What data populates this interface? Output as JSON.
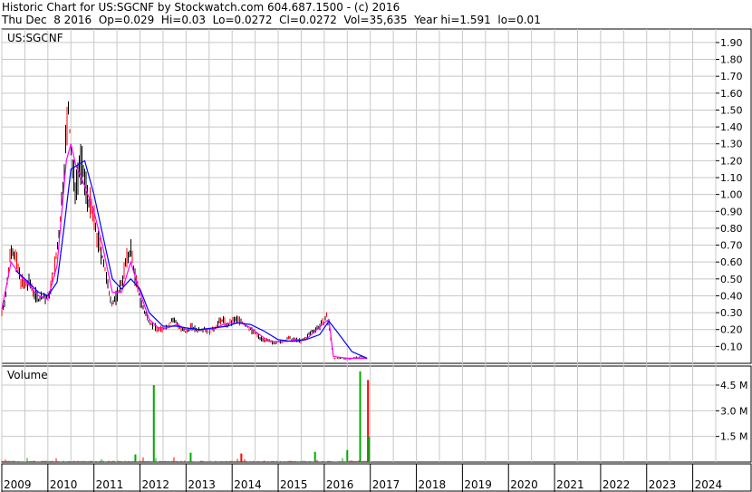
{
  "header": {
    "line1": "Historic Chart for US:SGCNF by Stockwatch.com 604.687.1500 - (c) 2016",
    "line2": "Thu Dec  8 2016  Op=0.029  Hi=0.03  Lo=0.0272  Cl=0.0272  Vol=35,635  Year hi=1.591  lo=0.01"
  },
  "colors": {
    "background": "#ffffff",
    "grid": "#c8c8c8",
    "price_bar": "#000000",
    "price_down": "#ff0000",
    "ma_short": "#ff00ff",
    "ma_long": "#0000ff",
    "volume_normal": "#ff0000",
    "volume_up": "#00aa00"
  },
  "chart_data": [
    {
      "type": "line",
      "label": "US:SGCNF",
      "ylim": [
        0,
        1.98
      ],
      "yticks": [
        "0.10",
        "0.20",
        "0.30",
        "0.40",
        "0.50",
        "0.60",
        "0.70",
        "0.80",
        "0.90",
        "1.00",
        "1.10",
        "1.20",
        "1.30",
        "1.40",
        "1.50",
        "1.60",
        "1.70",
        "1.80",
        "1.90"
      ],
      "ytick_values": [
        0.1,
        0.2,
        0.3,
        0.4,
        0.5,
        0.6,
        0.7,
        0.8,
        0.9,
        1.0,
        1.1,
        1.2,
        1.3,
        1.4,
        1.5,
        1.6,
        1.7,
        1.8,
        1.9
      ],
      "x_range": [
        2009.0,
        2024.5
      ],
      "xticks": [
        "2009",
        "2010",
        "2011",
        "2012",
        "2013",
        "2014",
        "2015",
        "2016",
        "2017",
        "2018",
        "2019",
        "2020",
        "2021",
        "2022",
        "2023",
        "2024"
      ],
      "grid": true,
      "series": [
        {
          "key": "price",
          "x": [
            2009.0,
            2009.1,
            2009.2,
            2009.3,
            2009.4,
            2009.5,
            2009.6,
            2009.7,
            2009.8,
            2009.9,
            2010.0,
            2010.1,
            2010.2,
            2010.3,
            2010.4,
            2010.45,
            2010.5,
            2010.55,
            2010.6,
            2010.7,
            2010.8,
            2010.9,
            2011.0,
            2011.1,
            2011.2,
            2011.3,
            2011.4,
            2011.5,
            2011.6,
            2011.7,
            2011.8,
            2011.9,
            2012.0,
            2012.1,
            2012.2,
            2012.3,
            2012.4,
            2012.5,
            2012.6,
            2012.7,
            2012.8,
            2012.9,
            2013.0,
            2013.1,
            2013.2,
            2013.3,
            2013.4,
            2013.5,
            2013.6,
            2013.7,
            2013.8,
            2013.9,
            2014.0,
            2014.1,
            2014.2,
            2014.3,
            2014.4,
            2014.5,
            2014.6,
            2014.7,
            2014.8,
            2014.9,
            2015.0,
            2015.1,
            2015.2,
            2015.3,
            2015.4,
            2015.5,
            2015.6,
            2015.7,
            2015.8,
            2015.9,
            2016.0,
            2016.05,
            2016.1,
            2016.2,
            2016.3,
            2016.4,
            2016.5,
            2016.6,
            2016.7,
            2016.8,
            2016.93
          ],
          "values": [
            0.3,
            0.42,
            0.7,
            0.62,
            0.5,
            0.45,
            0.48,
            0.42,
            0.38,
            0.4,
            0.38,
            0.5,
            0.65,
            0.95,
            1.35,
            1.5,
            1.25,
            1.1,
            1.05,
            1.2,
            1.08,
            0.95,
            0.85,
            0.7,
            0.62,
            0.45,
            0.35,
            0.4,
            0.48,
            0.6,
            0.68,
            0.5,
            0.38,
            0.3,
            0.25,
            0.22,
            0.2,
            0.2,
            0.22,
            0.26,
            0.24,
            0.2,
            0.18,
            0.22,
            0.2,
            0.2,
            0.21,
            0.18,
            0.2,
            0.24,
            0.26,
            0.22,
            0.25,
            0.26,
            0.25,
            0.22,
            0.2,
            0.18,
            0.15,
            0.14,
            0.13,
            0.12,
            0.13,
            0.12,
            0.15,
            0.14,
            0.14,
            0.13,
            0.15,
            0.18,
            0.2,
            0.22,
            0.25,
            0.28,
            0.22,
            0.03,
            0.03,
            0.03,
            0.025,
            0.03,
            0.035,
            0.04,
            0.0272
          ]
        },
        {
          "key": "ma_short",
          "x": [
            2009.0,
            2009.2,
            2009.4,
            2009.6,
            2009.8,
            2010.0,
            2010.2,
            2010.4,
            2010.5,
            2010.6,
            2010.8,
            2011.0,
            2011.2,
            2011.4,
            2011.6,
            2011.8,
            2012.0,
            2012.2,
            2012.4,
            2012.6,
            2012.8,
            2013.0,
            2013.2,
            2013.4,
            2013.6,
            2013.8,
            2014.0,
            2014.2,
            2014.4,
            2014.6,
            2014.8,
            2015.0,
            2015.2,
            2015.4,
            2015.6,
            2015.8,
            2016.0,
            2016.1,
            2016.2,
            2016.5,
            2016.93
          ],
          "values": [
            0.32,
            0.6,
            0.52,
            0.46,
            0.4,
            0.38,
            0.58,
            1.2,
            1.3,
            1.18,
            1.05,
            0.9,
            0.68,
            0.42,
            0.42,
            0.6,
            0.42,
            0.26,
            0.21,
            0.21,
            0.23,
            0.2,
            0.2,
            0.2,
            0.2,
            0.23,
            0.24,
            0.24,
            0.21,
            0.17,
            0.13,
            0.13,
            0.13,
            0.14,
            0.14,
            0.19,
            0.24,
            0.26,
            0.04,
            0.03,
            0.03
          ]
        },
        {
          "key": "ma_long",
          "x": [
            2009.3,
            2009.5,
            2009.8,
            2010.0,
            2010.2,
            2010.35,
            2010.5,
            2010.8,
            2011.0,
            2011.2,
            2011.4,
            2011.6,
            2011.8,
            2012.0,
            2012.2,
            2012.5,
            2012.8,
            2013.0,
            2013.3,
            2013.6,
            2013.9,
            2014.1,
            2014.4,
            2014.7,
            2015.0,
            2015.3,
            2015.6,
            2015.9,
            2016.1,
            2016.3,
            2016.6,
            2016.93
          ],
          "values": [
            0.55,
            0.5,
            0.42,
            0.4,
            0.48,
            0.8,
            1.15,
            1.2,
            1.0,
            0.75,
            0.5,
            0.44,
            0.5,
            0.44,
            0.3,
            0.22,
            0.22,
            0.21,
            0.2,
            0.21,
            0.22,
            0.24,
            0.23,
            0.19,
            0.14,
            0.13,
            0.14,
            0.17,
            0.25,
            0.18,
            0.07,
            0.03
          ]
        }
      ]
    },
    {
      "type": "bar",
      "title": "Volume",
      "ylim": [
        0,
        5.4
      ],
      "yticks": [
        "1.5 M",
        "3.0 M",
        "4.5 M"
      ],
      "ytick_values": [
        1.5,
        3.0,
        4.5
      ],
      "x_range": [
        2009.0,
        2024.5
      ],
      "grid": true,
      "spikes": [
        {
          "x": 2012.3,
          "value": 4.5,
          "color": "green"
        },
        {
          "x": 2016.78,
          "value": 5.3,
          "color": "green"
        },
        {
          "x": 2016.95,
          "value": 4.8,
          "color": "red"
        },
        {
          "x": 2016.97,
          "value": 1.5,
          "color": "green"
        },
        {
          "x": 2011.9,
          "value": 0.45,
          "color": "green"
        },
        {
          "x": 2013.1,
          "value": 0.55,
          "color": "green"
        },
        {
          "x": 2014.2,
          "value": 0.5,
          "color": "red"
        },
        {
          "x": 2015.8,
          "value": 0.6,
          "color": "green"
        },
        {
          "x": 2016.5,
          "value": 0.7,
          "color": "green"
        }
      ]
    }
  ]
}
